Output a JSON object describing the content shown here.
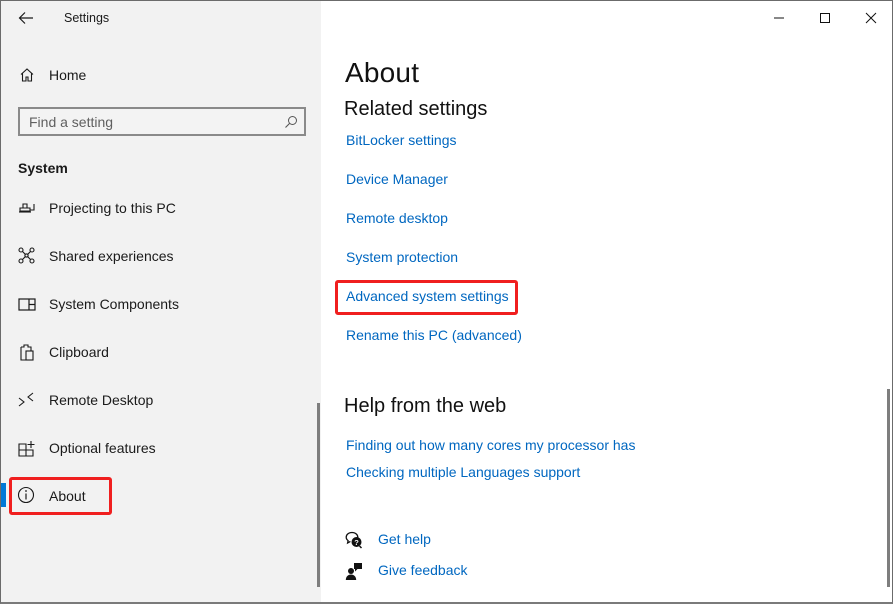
{
  "window": {
    "title": "Settings",
    "caption_buttons": [
      "minimize",
      "maximize",
      "close"
    ]
  },
  "nav": {
    "back_icon": "back-arrow-icon",
    "home": {
      "label": "Home",
      "icon": "home-icon"
    },
    "search": {
      "placeholder": "Find a setting",
      "value": "",
      "icon": "search-icon"
    },
    "section_heading": "System",
    "items": [
      {
        "label": "Projecting to this PC",
        "icon": "projector-icon",
        "selected": false
      },
      {
        "label": "Shared experiences",
        "icon": "shared-experiences-icon",
        "selected": false
      },
      {
        "label": "System Components",
        "icon": "system-components-icon",
        "selected": false
      },
      {
        "label": "Clipboard",
        "icon": "clipboard-icon",
        "selected": false
      },
      {
        "label": "Remote Desktop",
        "icon": "remote-desktop-icon",
        "selected": false
      },
      {
        "label": "Optional features",
        "icon": "optional-features-icon",
        "selected": false
      },
      {
        "label": "About",
        "icon": "info-icon",
        "selected": true,
        "highlighted": true
      }
    ]
  },
  "content": {
    "title": "About",
    "related_settings": {
      "heading": "Related settings",
      "links": [
        {
          "label": "BitLocker settings",
          "highlighted": false
        },
        {
          "label": "Device Manager",
          "highlighted": false
        },
        {
          "label": "Remote desktop",
          "highlighted": false
        },
        {
          "label": "System protection",
          "highlighted": false
        },
        {
          "label": "Advanced system settings",
          "highlighted": true
        },
        {
          "label": "Rename this PC (advanced)",
          "highlighted": false
        }
      ]
    },
    "help_from_web": {
      "heading": "Help from the web",
      "links": [
        {
          "label": "Finding out how many cores my processor has"
        },
        {
          "label": "Checking multiple Languages support"
        }
      ]
    },
    "support": [
      {
        "label": "Get help",
        "icon": "get-help-icon"
      },
      {
        "label": "Give feedback",
        "icon": "give-feedback-icon"
      }
    ]
  },
  "colors": {
    "accent": "#0078d7",
    "link": "#0067c0",
    "highlight": "#f01f1f",
    "nav_background": "#f2f2f2"
  }
}
